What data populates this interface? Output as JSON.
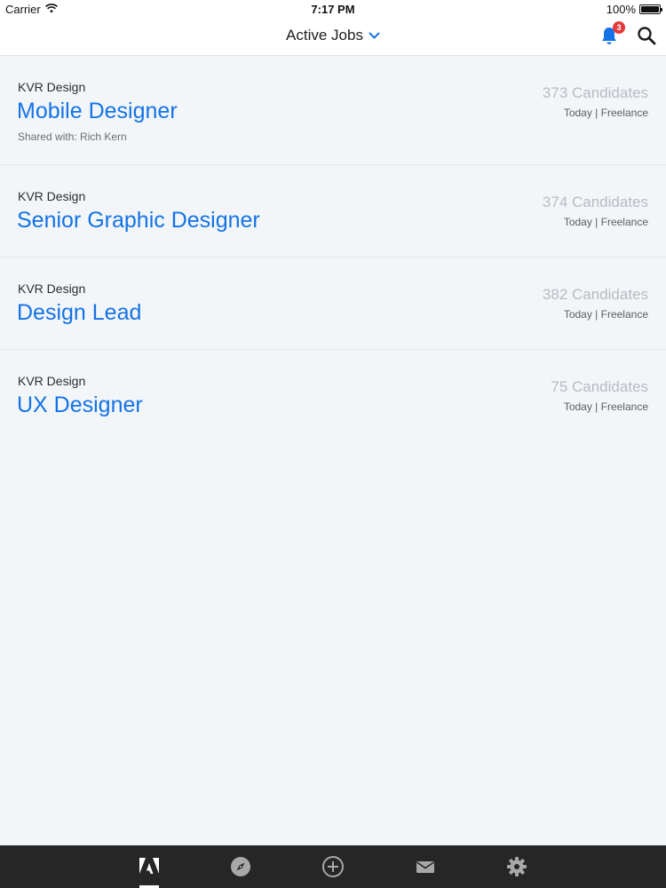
{
  "status_bar": {
    "carrier": "Carrier",
    "time": "7:17 PM",
    "battery": "100%",
    "battery_level": 1.0
  },
  "header": {
    "title": "Active Jobs",
    "notification_count": "3",
    "icons": [
      "chevron-down-icon",
      "bell-icon",
      "search-icon"
    ]
  },
  "jobs": [
    {
      "company": "KVR Design",
      "title": "Mobile Designer",
      "shared": "Shared with: Rich Kern",
      "candidates": "373 Candidates",
      "meta": "Today | Freelance"
    },
    {
      "company": "KVR Design",
      "title": "Senior Graphic Designer",
      "candidates": "374 Candidates",
      "meta": "Today | Freelance"
    },
    {
      "company": "KVR Design",
      "title": "Design Lead",
      "candidates": "382 Candidates",
      "meta": "Today | Freelance"
    },
    {
      "company": "KVR Design",
      "title": "UX Designer",
      "candidates": "75 Candidates",
      "meta": "Today | Freelance"
    }
  ],
  "tab_bar": {
    "tabs": [
      "adobe-logo-icon",
      "compass-icon",
      "add-circle-icon",
      "mail-icon",
      "gear-icon"
    ],
    "active_tab": "adobe-logo-icon"
  },
  "colors": {
    "accent": "#1473e6",
    "badge": "#e23b3b",
    "tab_bar_bg": "#262626",
    "list_bg": "#f3f6f9",
    "candidate_text": "#b6bcc2"
  }
}
